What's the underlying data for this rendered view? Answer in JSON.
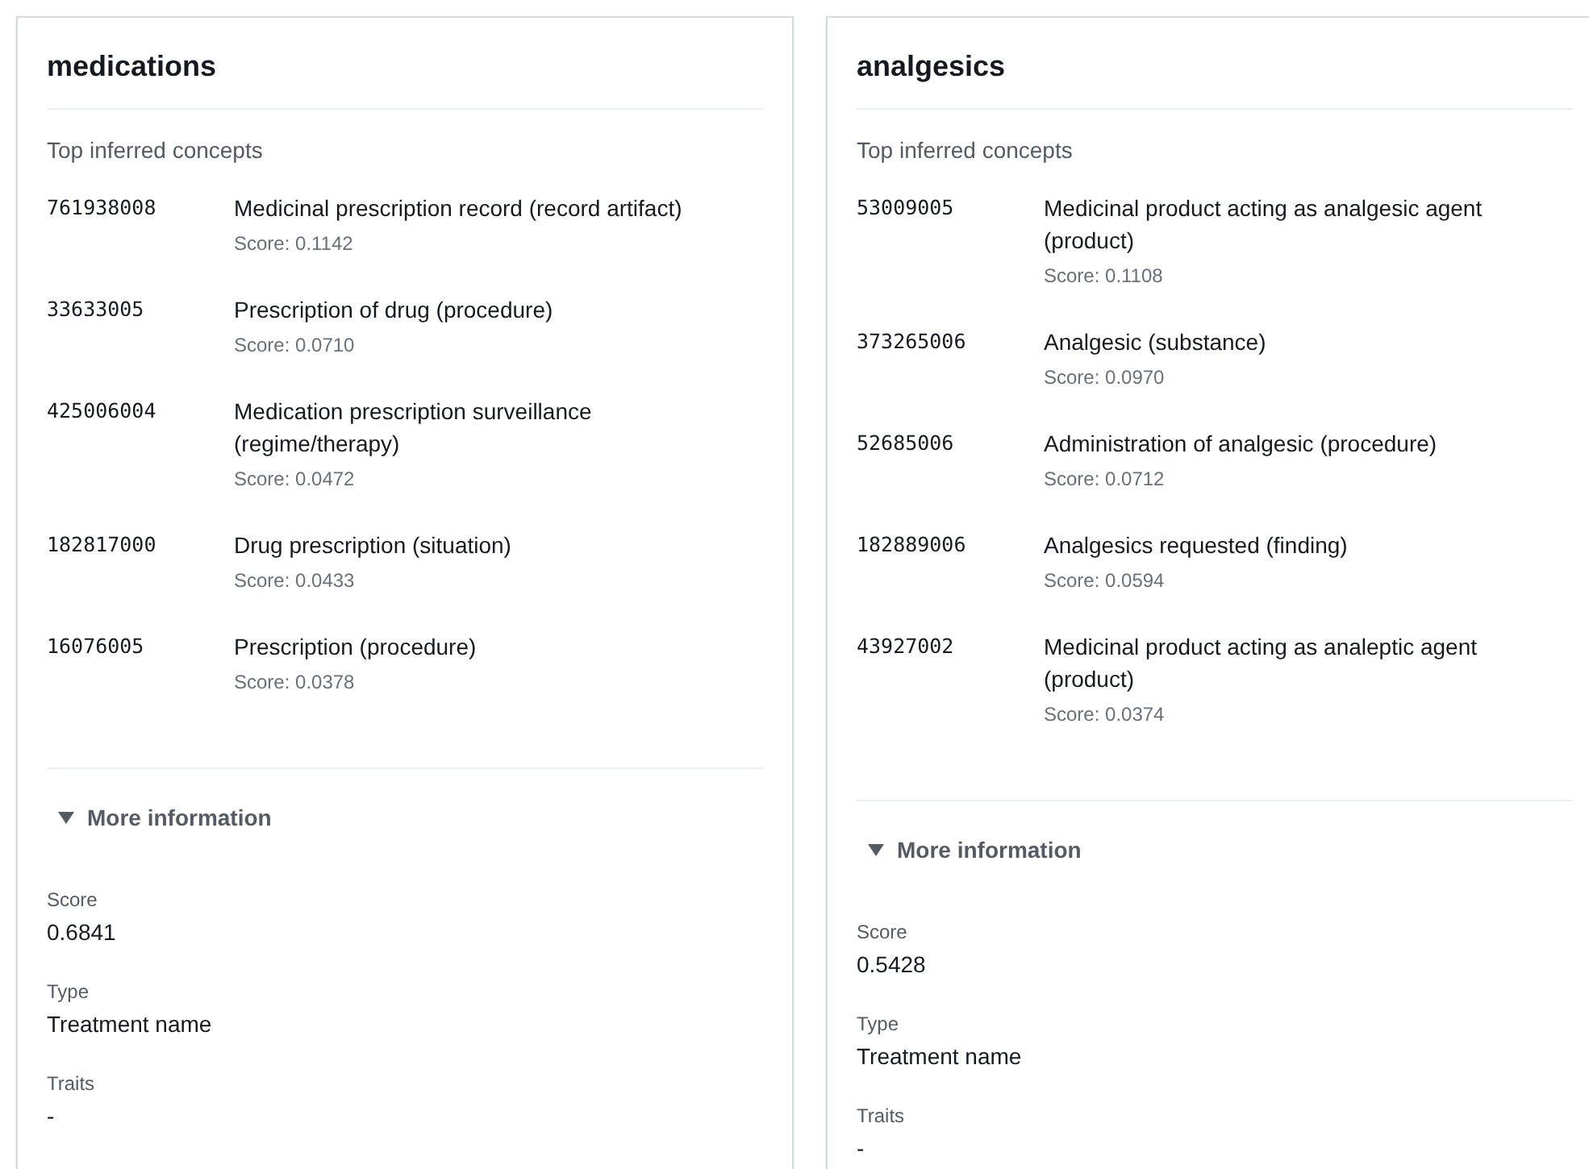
{
  "cards": [
    {
      "title": "medications",
      "concepts_label": "Top inferred concepts",
      "concepts": [
        {
          "code": "761938008",
          "name": "Medicinal prescription record (record artifact)",
          "score": "Score: 0.1142"
        },
        {
          "code": "33633005",
          "name": "Prescription of drug (procedure)",
          "score": "Score: 0.0710"
        },
        {
          "code": "425006004",
          "name": "Medication prescription surveillance (regime/therapy)",
          "score": "Score: 0.0472"
        },
        {
          "code": "182817000",
          "name": "Drug prescription (situation)",
          "score": "Score: 0.0433"
        },
        {
          "code": "16076005",
          "name": "Prescription (procedure)",
          "score": "Score: 0.0378"
        }
      ],
      "more_info": {
        "label": "More information",
        "expanded": true,
        "fields": [
          {
            "label": "Score",
            "value": "0.6841"
          },
          {
            "label": "Type",
            "value": "Treatment name"
          },
          {
            "label": "Traits",
            "value": "-"
          }
        ]
      }
    },
    {
      "title": "analgesics",
      "concepts_label": "Top inferred concepts",
      "concepts": [
        {
          "code": "53009005",
          "name": "Medicinal product acting as analgesic agent (product)",
          "score": "Score: 0.1108"
        },
        {
          "code": "373265006",
          "name": "Analgesic (substance)",
          "score": "Score: 0.0970"
        },
        {
          "code": "52685006",
          "name": "Administration of analgesic (procedure)",
          "score": "Score: 0.0712"
        },
        {
          "code": "182889006",
          "name": "Analgesics requested (finding)",
          "score": "Score: 0.0594"
        },
        {
          "code": "43927002",
          "name": "Medicinal product acting as analeptic agent (product)",
          "score": "Score: 0.0374"
        }
      ],
      "more_info": {
        "label": "More information",
        "expanded": true,
        "fields": [
          {
            "label": "Score",
            "value": "0.5428"
          },
          {
            "label": "Type",
            "value": "Treatment name"
          },
          {
            "label": "Traits",
            "value": "-"
          }
        ]
      }
    }
  ]
}
